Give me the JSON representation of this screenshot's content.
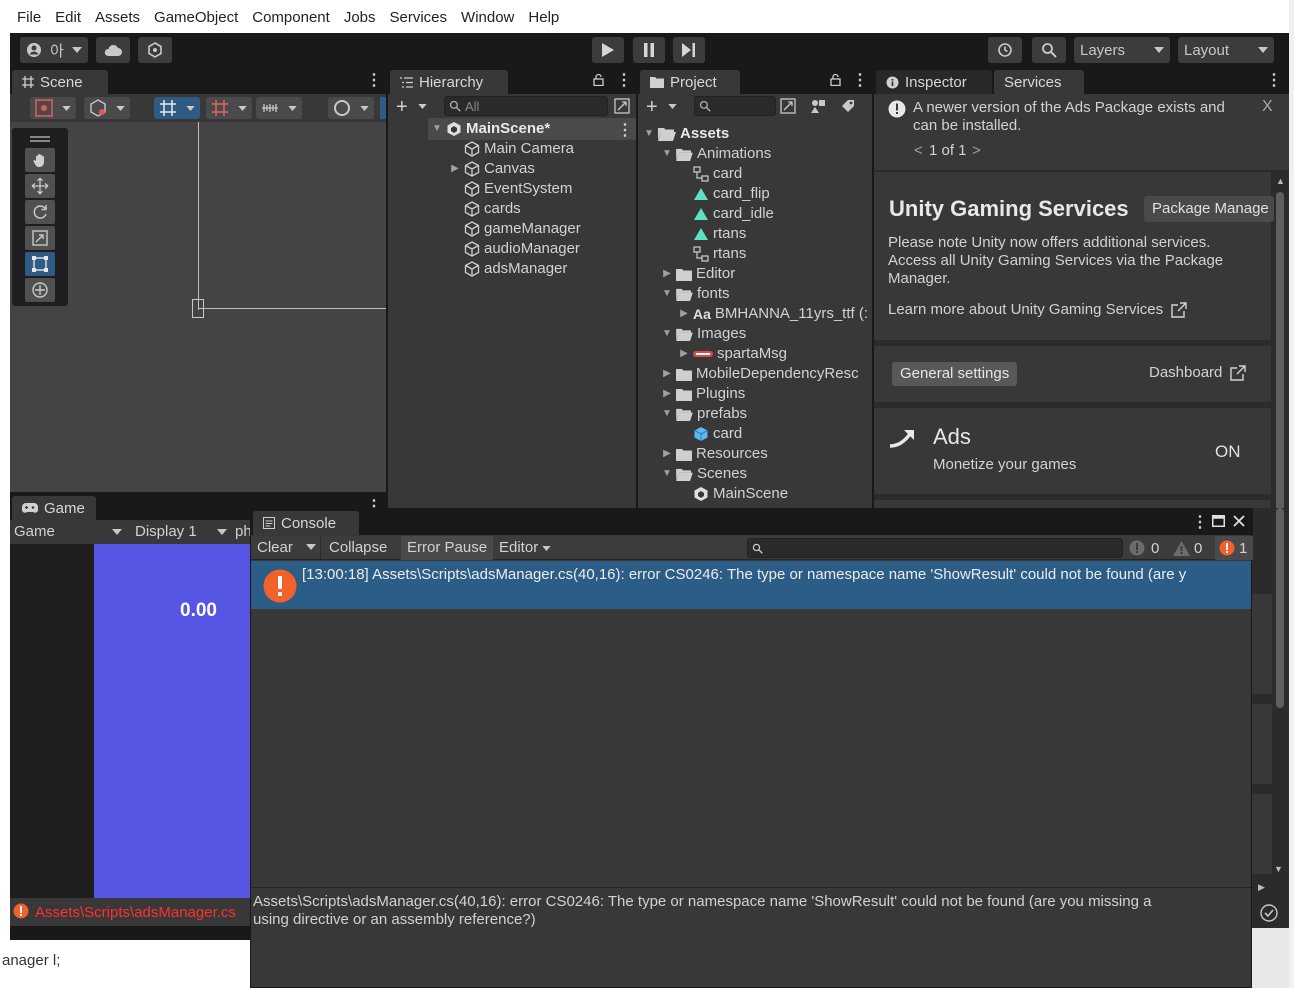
{
  "menu": [
    "File",
    "Edit",
    "Assets",
    "GameObject",
    "Component",
    "Jobs",
    "Services",
    "Window",
    "Help"
  ],
  "toolbar": {
    "account_label": "아",
    "layers_label": "Layers",
    "layout_label": "Layout"
  },
  "scene": {
    "tab_label": "Scene"
  },
  "hierarchy": {
    "tab_label": "Hierarchy",
    "search_placeholder": "All",
    "scene_name": "MainScene*",
    "items": [
      "Main Camera",
      "Canvas",
      "EventSystem",
      "cards",
      "gameManager",
      "audioManager",
      "adsManager"
    ]
  },
  "project": {
    "tab_label": "Project",
    "root": "Assets",
    "items": [
      {
        "label": "Animations",
        "indent": 1,
        "expanded": true,
        "kind": "folder"
      },
      {
        "label": "card",
        "indent": 2,
        "kind": "animator"
      },
      {
        "label": "card_flip",
        "indent": 2,
        "kind": "anim"
      },
      {
        "label": "card_idle",
        "indent": 2,
        "kind": "anim"
      },
      {
        "label": "rtans",
        "indent": 2,
        "kind": "anim"
      },
      {
        "label": "rtans",
        "indent": 2,
        "kind": "animator"
      },
      {
        "label": "Editor",
        "indent": 1,
        "expanded": false,
        "kind": "folder"
      },
      {
        "label": "fonts",
        "indent": 1,
        "expanded": true,
        "kind": "folder"
      },
      {
        "label": "BMHANNA_11yrs_ttf (:",
        "indent": 2,
        "kind": "font",
        "collapsible": true
      },
      {
        "label": "Images",
        "indent": 1,
        "expanded": true,
        "kind": "folder"
      },
      {
        "label": "spartaMsg",
        "indent": 2,
        "kind": "sprite",
        "collapsible": true
      },
      {
        "label": "MobileDependencyResc",
        "indent": 1,
        "expanded": false,
        "kind": "folder"
      },
      {
        "label": "Plugins",
        "indent": 1,
        "expanded": false,
        "kind": "folder"
      },
      {
        "label": "prefabs",
        "indent": 1,
        "expanded": true,
        "kind": "folder"
      },
      {
        "label": "card",
        "indent": 2,
        "kind": "prefab"
      },
      {
        "label": "Resources",
        "indent": 1,
        "expanded": false,
        "kind": "folder"
      },
      {
        "label": "Scenes",
        "indent": 1,
        "expanded": true,
        "kind": "folder"
      },
      {
        "label": "MainScene",
        "indent": 2,
        "kind": "unity"
      }
    ],
    "font_prefix": "Aa"
  },
  "inspector": {
    "tab_label": "Inspector",
    "services_tab_label": "Services",
    "notice_line1": "A newer version of the Ads Package exists and",
    "notice_line2": "can be installed.",
    "pager": "1 of 1",
    "ugs_title": "Unity Gaming Services",
    "package_manager_button": "Package Manage",
    "ugs_desc_1": "Please note Unity now offers additional services.",
    "ugs_desc_2": "Access all Unity Gaming Services via the Package",
    "ugs_desc_3": "Manager.",
    "learn_more": "Learn more about Unity Gaming Services",
    "general_settings": "General settings",
    "dashboard": "Dashboard",
    "ads_title": "Ads",
    "ads_subtitle": "Monetize your games",
    "ads_status": "ON"
  },
  "game": {
    "tab_label": "Game",
    "mode_label": "Game",
    "display_label": "Display 1",
    "extra_label": "ph",
    "score": "0.00",
    "status_error": "Assets\\Scripts\\adsManager.cs"
  },
  "console": {
    "tab_label": "Console",
    "clear": "Clear",
    "collapse": "Collapse",
    "error_pause": "Error Pause",
    "editor": "Editor",
    "log_count": "0",
    "warn_count": "0",
    "error_count": "1",
    "entry": "[13:00:18] Assets\\Scripts\\adsManager.cs(40,16): error CS0246: The type or namespace name 'ShowResult' could not be found (are y",
    "detail_line1": "Assets\\Scripts\\adsManager.cs(40,16): error CS0246: The type or namespace name 'ShowResult' could not be found (are you missing a",
    "detail_line2": "using directive or an assembly reference?)"
  },
  "background": {
    "bottom_text": "anager l;"
  },
  "colors": {
    "accent_blue": "#2c5d87",
    "game_blue": "#5755e3",
    "error_orange": "#f0622a",
    "panel": "#383838"
  }
}
